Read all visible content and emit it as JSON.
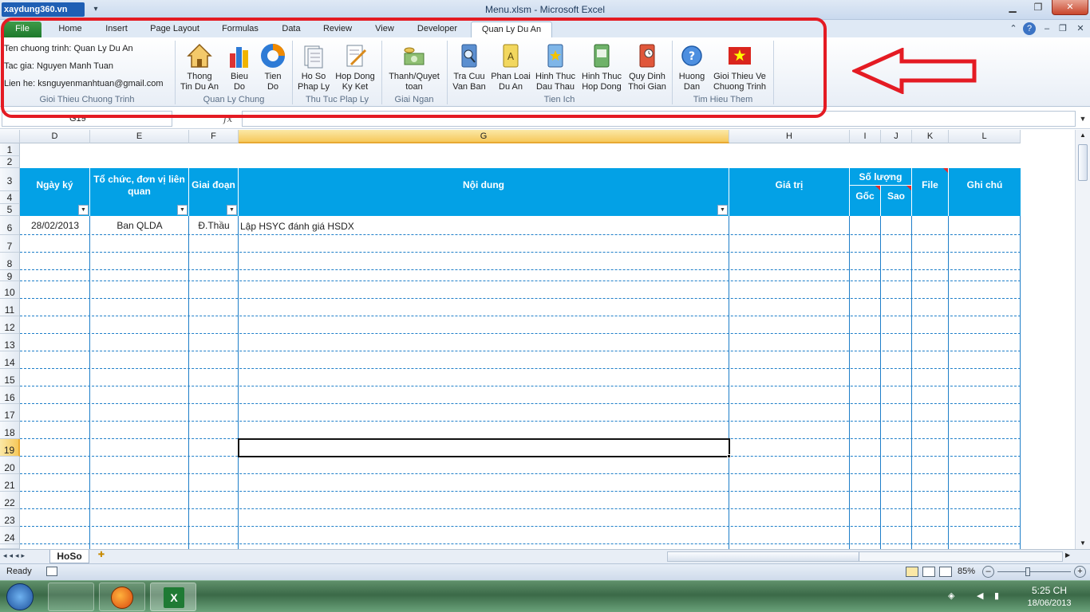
{
  "window": {
    "title": "Menu.xlsm  -  Microsoft Excel",
    "logo": "xaydung360.vn",
    "minimize_icon": "minimize-icon",
    "restore_icon": "restore-icon",
    "close_icon": "close-icon"
  },
  "tabs": [
    "File",
    "Home",
    "Insert",
    "Page Layout",
    "Formulas",
    "Data",
    "Review",
    "View",
    "Developer",
    "Quan Ly Du An"
  ],
  "ribbon": {
    "info": {
      "program": "Ten chuong trinh: Quan Ly Du An",
      "author": "Tac gia: Nguyen Manh Tuan",
      "contact": "Lien he: ksnguyenmanhtuan@gmail.com",
      "group_label": "Gioi Thieu Chuong Trinh"
    },
    "groups": [
      {
        "label": "Quan Ly Chung",
        "buttons": [
          {
            "line1": "Thong",
            "line2": "Tin Du An",
            "icon": "house-icon"
          },
          {
            "line1": "Bieu",
            "line2": "Do",
            "icon": "bar-chart-icon"
          },
          {
            "line1": "Tien",
            "line2": "Do",
            "icon": "donut-chart-icon"
          }
        ]
      },
      {
        "label": "Thu Tuc Plap Ly",
        "buttons": [
          {
            "line1": "Ho So",
            "line2": "Phap Ly",
            "icon": "documents-icon"
          },
          {
            "line1": "Hop Dong",
            "line2": "Ky Ket",
            "icon": "contract-pen-icon"
          }
        ]
      },
      {
        "label": "Giai Ngan",
        "buttons": [
          {
            "line1": "Thanh/Quyet",
            "line2": "toan",
            "icon": "money-icon"
          }
        ]
      },
      {
        "label": "Tien Ich",
        "buttons": [
          {
            "line1": "Tra Cuu",
            "line2": "Van Ban",
            "icon": "search-book-icon"
          },
          {
            "line1": "Phan Loai",
            "line2": "Du An",
            "icon": "book-a-icon"
          },
          {
            "line1": "Hinh Thuc",
            "line2": "Dau Thau",
            "icon": "book-star-icon"
          },
          {
            "line1": "Hinh Thuc",
            "line2": "Hop Dong",
            "icon": "book-image-icon"
          },
          {
            "line1": "Quy Dinh",
            "line2": "Thoi Gian",
            "icon": "book-clock-icon"
          }
        ]
      },
      {
        "label": "Tim Hieu Them",
        "buttons": [
          {
            "line1": "Huong",
            "line2": "Dan",
            "icon": "help-icon"
          },
          {
            "line1": "Gioi Thieu Ve",
            "line2": "Chuong Trinh",
            "icon": "vietnam-flag-icon"
          }
        ]
      }
    ]
  },
  "formula_bar": {
    "name_box": "G19",
    "fx": "fx",
    "content": ""
  },
  "columns": [
    "D",
    "E",
    "F",
    "G",
    "H",
    "I",
    "J",
    "K",
    "L"
  ],
  "rows": [
    "1",
    "2",
    "3",
    "4",
    "5",
    "6",
    "7",
    "8",
    "9",
    "10",
    "11",
    "12",
    "13",
    "14",
    "15",
    "16",
    "17",
    "18",
    "19",
    "20",
    "21",
    "22",
    "23",
    "24"
  ],
  "table_headers": {
    "ngay_ky": "Ngày ký",
    "to_chuc": "Tổ chức, đơn vị liên quan",
    "giai_doan": "Giai đoạn",
    "noi_dung": "Nội dung",
    "gia_tri": "Giá trị",
    "so_luong": "Số lượng",
    "goc": "Gốc",
    "sao": "Sao",
    "file": "File",
    "ghi_chu": "Ghi chú"
  },
  "data_rows": [
    {
      "ngay_ky": "28/02/2013",
      "to_chuc": "Ban QLDA",
      "giai_doan": "Đ.Thầu",
      "noi_dung": "Lập HSYC đánh giá HSDX"
    }
  ],
  "selected_cell": "G19",
  "sheet_tabs": [
    "HoSo"
  ],
  "status": {
    "ready": "Ready",
    "zoom": "85%"
  },
  "taskbar": {
    "time": "5:25 CH",
    "date": "18/06/2013"
  },
  "colors": {
    "header_blue": "#03a1e6",
    "annotation_red": "#e41b23",
    "file_tab_green": "#2a8a3a"
  }
}
